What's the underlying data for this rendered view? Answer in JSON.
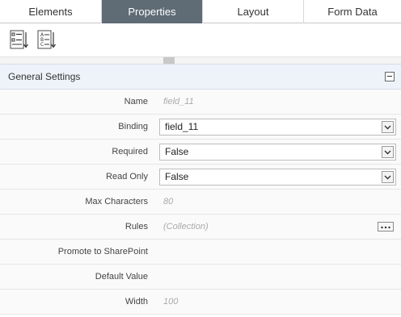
{
  "tabs": [
    {
      "label": "Elements",
      "active": false
    },
    {
      "label": "Properties",
      "active": true
    },
    {
      "label": "Layout",
      "active": false
    },
    {
      "label": "Form Data",
      "active": false
    }
  ],
  "toolbar": {
    "categorized_icon": "categorized-view-icon",
    "alphabetical_icon": "alphabetical-sort-icon"
  },
  "section": {
    "title": "General Settings"
  },
  "properties": [
    {
      "label": "Name",
      "value": "field_11",
      "kind": "text"
    },
    {
      "label": "Binding",
      "value": "field_11",
      "kind": "select"
    },
    {
      "label": "Required",
      "value": "False",
      "kind": "select"
    },
    {
      "label": "Read Only",
      "value": "False",
      "kind": "select"
    },
    {
      "label": "Max Characters",
      "value": "80",
      "kind": "text"
    },
    {
      "label": "Rules",
      "value": "(Collection)",
      "kind": "collection"
    },
    {
      "label": "Promote to SharePoint",
      "value": "",
      "kind": "text"
    },
    {
      "label": "Default Value",
      "value": "",
      "kind": "text"
    },
    {
      "label": "Width",
      "value": "100",
      "kind": "text"
    }
  ],
  "colors": {
    "active_tab": "#5f6b75",
    "section_header": "#eef3fa"
  }
}
